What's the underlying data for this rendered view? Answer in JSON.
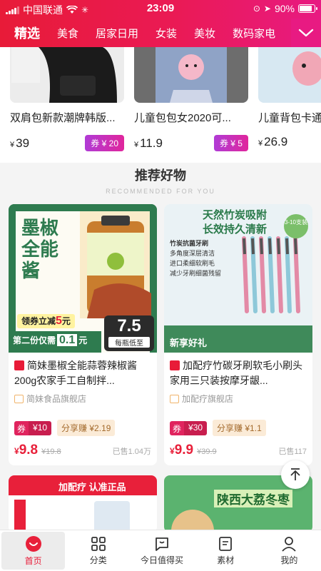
{
  "status": {
    "carrier": "中国联通",
    "time": "23:09",
    "battery": "90%"
  },
  "categories": [
    "精选",
    "美食",
    "居家日用",
    "女装",
    "美妆",
    "数码家电"
  ],
  "top_products": [
    {
      "title": "双肩包新款潮牌韩版...",
      "currency": "¥",
      "price": "39",
      "coupon": "券 ¥ 20"
    },
    {
      "title": "儿童包包女2020可...",
      "currency": "¥",
      "price": "11.9",
      "coupon": "券 ¥ 5"
    },
    {
      "title": "儿童背包卡通",
      "currency": "¥",
      "price": "26.9",
      "coupon": ""
    }
  ],
  "recommend": {
    "title": "推荐好物",
    "subtitle": "RECOMMENDED FOR YOU"
  },
  "products": [
    {
      "name": "简妹墨椒全能蒜蓉辣椒酱200g农家手工自制拌...",
      "shop": "简妹食品旗舰店",
      "coupon_label": "券",
      "coupon_value": "¥10",
      "share": "分享赚 ¥2.19",
      "price_symbol": "¥",
      "price": "9.8",
      "original": "¥19.8",
      "sold": "已售1.04万",
      "img_text": {
        "brand": "墨椒全能酱",
        "promo1": "领券立减",
        "promo1_num": "5",
        "promo1_unit": "元",
        "promo2": "第二份仅需",
        "promo2_num": "0.1",
        "promo2_unit": "元",
        "big_price": "7.5",
        "per_bottle": "每瓶低至"
      }
    },
    {
      "name": "加配疗竹碳牙刷软毛小刷头家用三只装按摩牙龈...",
      "shop": "加配疗旗舰店",
      "coupon_label": "券",
      "coupon_value": "¥30",
      "share": "分享赚 ¥1.1",
      "price_symbol": "¥",
      "price": "9.9",
      "original": "¥39.9",
      "sold": "已售117",
      "img_text": {
        "headline1": "天然竹炭吸附",
        "headline2": "长效持久清新",
        "badge": "3-10支装",
        "sub": "竹炭抗菌牙刷",
        "f1": "多角度深层清洁",
        "f2": "进口柔细软刷毛",
        "f3": "减少牙刷细菌残留",
        "new": "新享好礼"
      }
    }
  ],
  "bottom_cards": [
    {
      "label": "加配疗 认准正品"
    },
    {
      "label": "陕西大荔冬枣"
    }
  ],
  "tabbar": [
    {
      "label": "首页",
      "icon": "home-icon"
    },
    {
      "label": "分类",
      "icon": "grid-icon"
    },
    {
      "label": "今日值得买",
      "icon": "flag-icon"
    },
    {
      "label": "素材",
      "icon": "document-icon"
    },
    {
      "label": "我的",
      "icon": "person-icon"
    }
  ],
  "colors": {
    "accent": "#e81b38",
    "gradient_end": "#e81a82"
  }
}
